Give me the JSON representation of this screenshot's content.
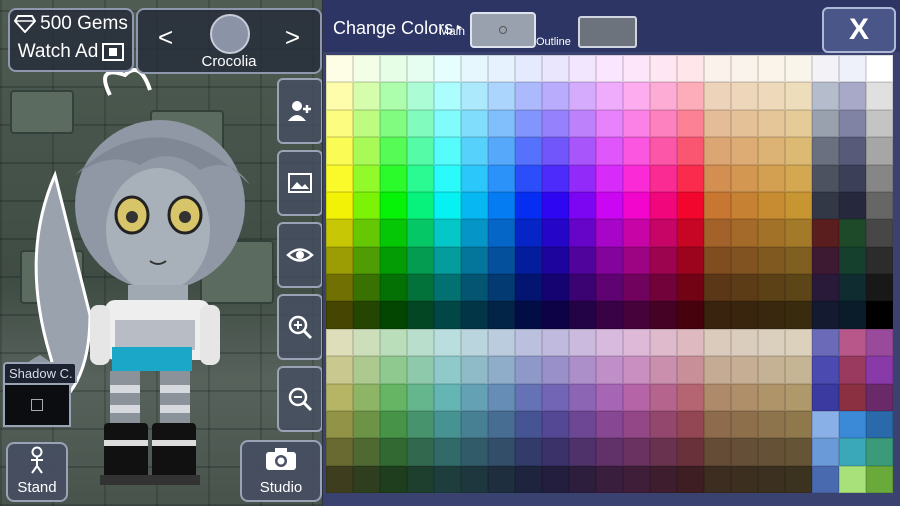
{
  "hud": {
    "gems_label": "500 Gems",
    "watch_ad_label": "Watch Ad",
    "character_name": "Crocolia",
    "prev_arrow": "<",
    "next_arrow": ">",
    "shadow_label": "Shadow C.",
    "stand_label": "Stand",
    "studio_label": "Studio"
  },
  "panel": {
    "title": "Change Colors",
    "main_label": "Main",
    "outline_label": "Outline",
    "close_label": "X",
    "main_color": "#9aa1ae",
    "outline_color": "#6d737d"
  },
  "palette": {
    "rows": 16,
    "cols": 18,
    "extra_cols": 3
  }
}
